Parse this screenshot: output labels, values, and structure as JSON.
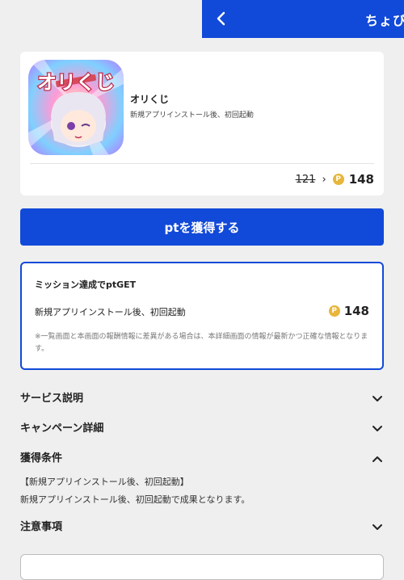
{
  "header": {
    "title": "ちょび"
  },
  "app": {
    "icon_text": "オリくじ",
    "name": "オリくじ",
    "condition": "新規アプリインストール後、初回起動",
    "old_points": "121",
    "new_points": "148",
    "coin_symbol": "P"
  },
  "cta": {
    "label": "ptを獲得する"
  },
  "mission": {
    "title": "ミッション達成でptGET",
    "row_label": "新規アプリインストール後、初回起動",
    "row_points": "148",
    "note": "※一覧画面と本画面の報酬情報に差異がある場合は、本詳細画面の情報が最新かつ正確な情報となります。"
  },
  "sections": {
    "service": {
      "label": "サービス説明",
      "state": "collapsed"
    },
    "campaign": {
      "label": "キャンペーン詳細",
      "state": "collapsed"
    },
    "conditions": {
      "label": "獲得条件",
      "state": "expanded",
      "line1": "【新規アプリインストール後、初回起動】",
      "line2": "新規アプリインストール後、初回起動で成果となります。"
    },
    "notes": {
      "label": "注意事項",
      "state": "collapsed"
    }
  },
  "colors": {
    "accent": "#1149d8",
    "coin": "#e7b63a",
    "background": "#efefef"
  }
}
